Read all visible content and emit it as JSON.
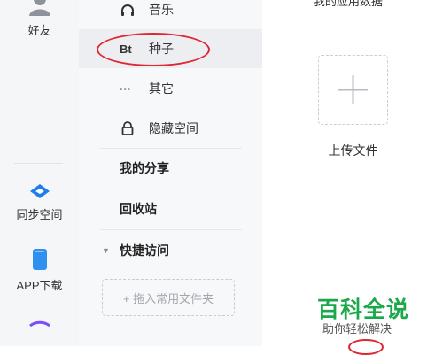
{
  "rail": {
    "friends": "好友",
    "sync": "同步空间",
    "app": "APP下载"
  },
  "nav": {
    "music": "音乐",
    "torrent_glyph": "Bt",
    "torrent": "种子",
    "other_glyph": "···",
    "other": "其它",
    "hidden": "隐藏空间",
    "my_share": "我的分享",
    "recycle": "回收站",
    "quick_access": "快捷访问",
    "drag_hint": "+ 拖入常用文件夹"
  },
  "main": {
    "top_text": "我的应用数据",
    "upload_label": "上传文件"
  },
  "watermark": {
    "big": "百科全说",
    "small": "助你轻松解决"
  },
  "colors": {
    "highlight": "#e0272f",
    "watermark": "#1aa84a",
    "sync_icon": "#1f7ee8",
    "app_icon": "#2f90f0"
  }
}
